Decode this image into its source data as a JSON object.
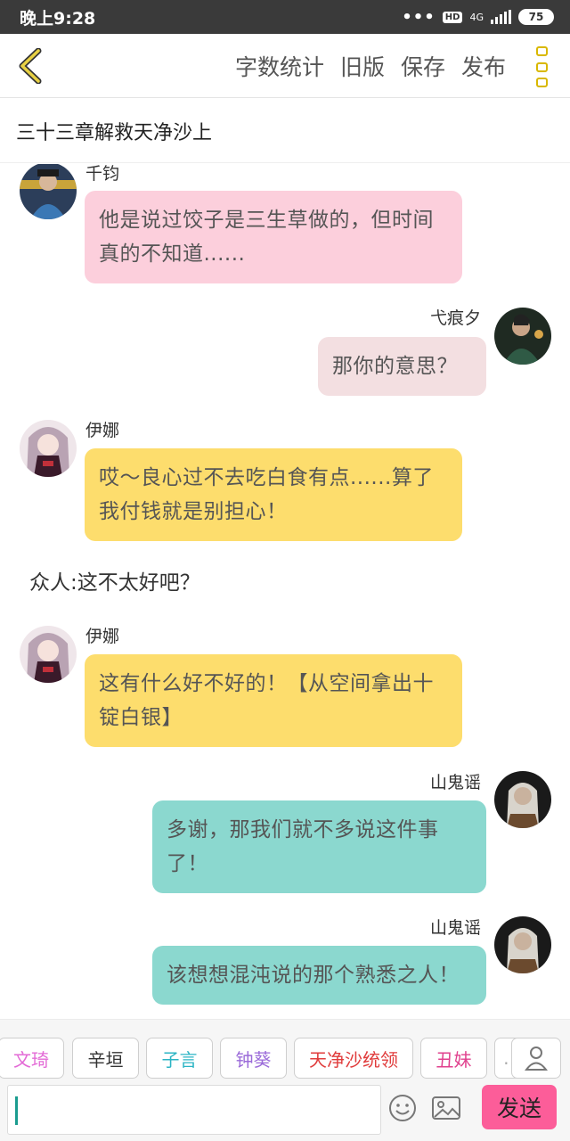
{
  "status_bar": {
    "time": "晚上9:28",
    "dots": "•••",
    "hd": "HD",
    "network": "4G",
    "battery": "75"
  },
  "toolbar": {
    "back_icon": "chevron-left-icon",
    "actions": [
      "字数统计",
      "旧版",
      "保存",
      "发布"
    ],
    "more_icon": "more-icon",
    "accent_color": "#d9b800"
  },
  "chapter": {
    "title": "三十三章解救天净沙上"
  },
  "messages": [
    {
      "speaker": "千钧",
      "side": "left",
      "text": "他是说过饺子是三生草做的，但时间真的不知道......",
      "color": "#fccfdc"
    },
    {
      "speaker": "弋痕夕",
      "side": "right",
      "text": "那你的意思？",
      "color": "#f3dfe1"
    },
    {
      "speaker": "伊娜",
      "side": "left",
      "text": "哎～良心过不去吃白食有点......算了我付钱就是别担心！",
      "color": "#fddd6d"
    },
    {
      "narration": "众人:这不太好吧？"
    },
    {
      "speaker": "伊娜",
      "side": "left",
      "text": "这有什么好不好的！【从空间拿出十锭白银】",
      "color": "#fddd6d"
    },
    {
      "speaker": "山鬼谣",
      "side": "right",
      "text": "多谢，那我们就不多说这件事了！",
      "color": "#8bd8cf"
    },
    {
      "speaker": "山鬼谣",
      "side": "right",
      "text": "该想想混沌说的那个熟悉之人！",
      "color": "#8bd8cf"
    }
  ],
  "roles": [
    {
      "name": "文琦",
      "color": "#e36ad6"
    },
    {
      "name": "辛垣",
      "color": "#333333"
    },
    {
      "name": "子言",
      "color": "#2bb4c4"
    },
    {
      "name": "钟葵",
      "color": "#9b6bd9"
    },
    {
      "name": "天净沙统领",
      "color": "#e03c3c"
    },
    {
      "name": "丑妹",
      "color": "#e0418e"
    },
    {
      "name": "…",
      "color": "#aaaaaa"
    }
  ],
  "input": {
    "placeholder": "",
    "emoji_icon": "smiley-icon",
    "image_icon": "image-icon",
    "send_label": "发送",
    "send_color": "#fc5d99"
  },
  "user_icon": "user-icon"
}
